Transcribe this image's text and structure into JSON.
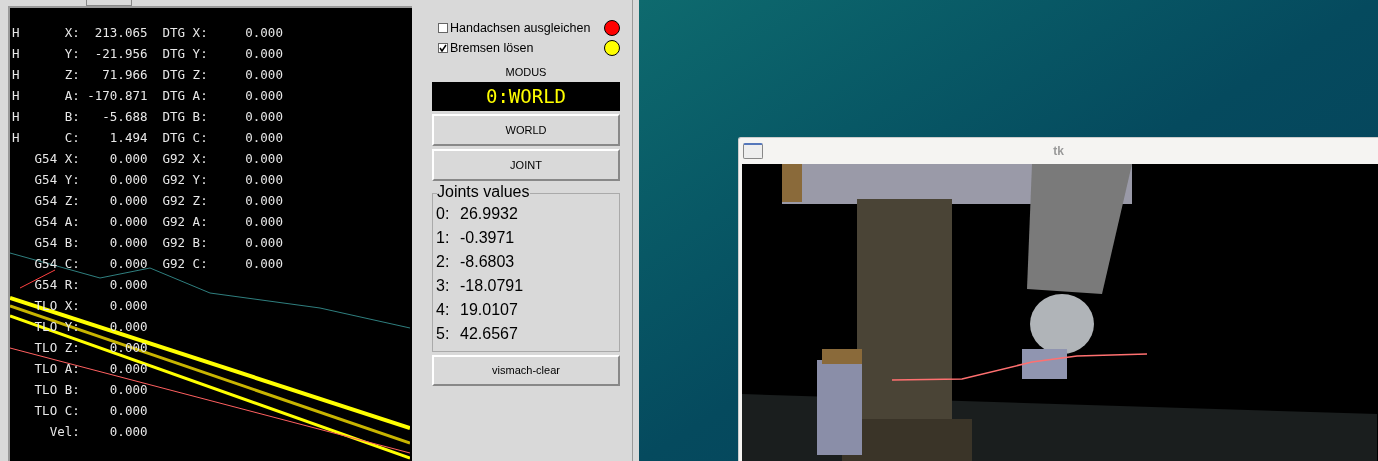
{
  "dro": {
    "rows": [
      "H      X:  213.065  DTG X:     0.000",
      "H      Y:  -21.956  DTG Y:     0.000",
      "H      Z:   71.966  DTG Z:     0.000",
      "H      A: -170.871  DTG A:     0.000",
      "H      B:   -5.688  DTG B:     0.000",
      "H      C:    1.494  DTG C:     0.000",
      "   G54 X:    0.000  G92 X:     0.000",
      "   G54 Y:    0.000  G92 Y:     0.000",
      "   G54 Z:    0.000  G92 Z:     0.000",
      "   G54 A:    0.000  G92 A:     0.000",
      "   G54 B:    0.000  G92 B:     0.000",
      "   G54 C:    0.000  G92 C:     0.000",
      "   G54 R:    0.000",
      "   TLO X:    0.000",
      "   TLO Y:    0.000",
      "   TLO Z:    0.000",
      "   TLO A:    0.000",
      "   TLO B:    0.000",
      "   TLO C:    0.000",
      "     Vel:    0.000"
    ]
  },
  "controls": {
    "options": [
      {
        "label": "Handachsen ausgleichen",
        "checked": false,
        "color": "#ff0000"
      },
      {
        "label": "Bremsen lösen",
        "checked": true,
        "color": "#ffff00"
      }
    ],
    "mode_label": "MODUS",
    "mode_display": "0:WORLD",
    "mode_buttons": [
      "WORLD",
      "JOINT"
    ],
    "joints": {
      "title": "Joints values",
      "values": [
        {
          "index": "0:",
          "value": "26.9932"
        },
        {
          "index": "1:",
          "value": "-0.3971"
        },
        {
          "index": "2:",
          "value": "-8.6803"
        },
        {
          "index": "3:",
          "value": "-18.0791"
        },
        {
          "index": "4:",
          "value": "19.0107"
        },
        {
          "index": "5:",
          "value": "42.6567"
        }
      ]
    },
    "clear_button": "vismach-clear"
  },
  "window": {
    "title": "tk"
  }
}
